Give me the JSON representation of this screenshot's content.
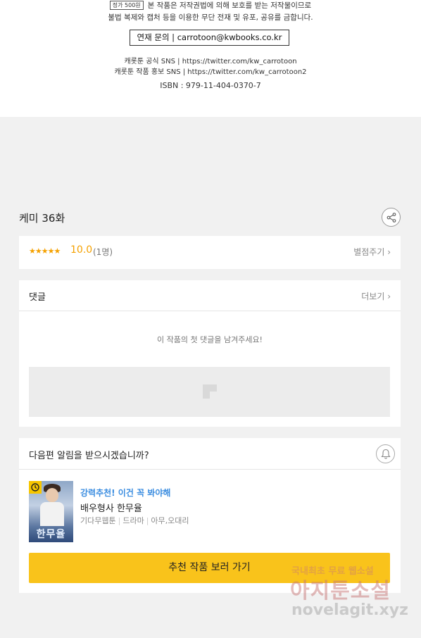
{
  "copyright": {
    "price_tag": "정가 500원",
    "notice_line1": "본 작품은 저작권법에 의해 보호를 받는 저작물이므로",
    "notice_line2": "불법 복제와 캡처 등을 이용한 무단 전재 및 유포, 공유를 금합니다.",
    "contact": "연재 문의 | carrotoon@kwbooks.co.kr",
    "sns_official": "캐롯툰 공식 SNS | https://twitter.com/kw_carrotoon",
    "sns_promo": "캐롯툰 작품 홍보 SNS | https://twitter.com/kw_carrotoon2",
    "isbn": "ISBN : 979-11-404-0370-7"
  },
  "episode": {
    "title": "케미 36화"
  },
  "rating": {
    "stars": "★★★★★",
    "score": "10.0",
    "count": "(1명)",
    "rate_button": "별점주기 ›"
  },
  "comments": {
    "title": "댓글",
    "more": "더보기 ›",
    "empty_message": "이 작품의 첫 댓글을 남겨주세요!"
  },
  "notification": {
    "question": "다음편 알림을 받으시겠습니까?",
    "recommend": {
      "promo": "강력추천! 이건 꼭 봐야해",
      "title": "배우형사 한무율",
      "tags": [
        "기다무웹툰",
        "드라마",
        "아무,오대리"
      ],
      "thumb_logo": "한무율",
      "button": "추천 작품 보러 가기"
    }
  },
  "watermark": {
    "line1": "국내최초 무료 웹소설",
    "line2": "아지툰소설",
    "line3": "novelagit.xyz"
  },
  "colors": {
    "accent_yellow": "#f9c31b",
    "star_orange": "#f5a100",
    "promo_blue": "#3b8de0"
  }
}
